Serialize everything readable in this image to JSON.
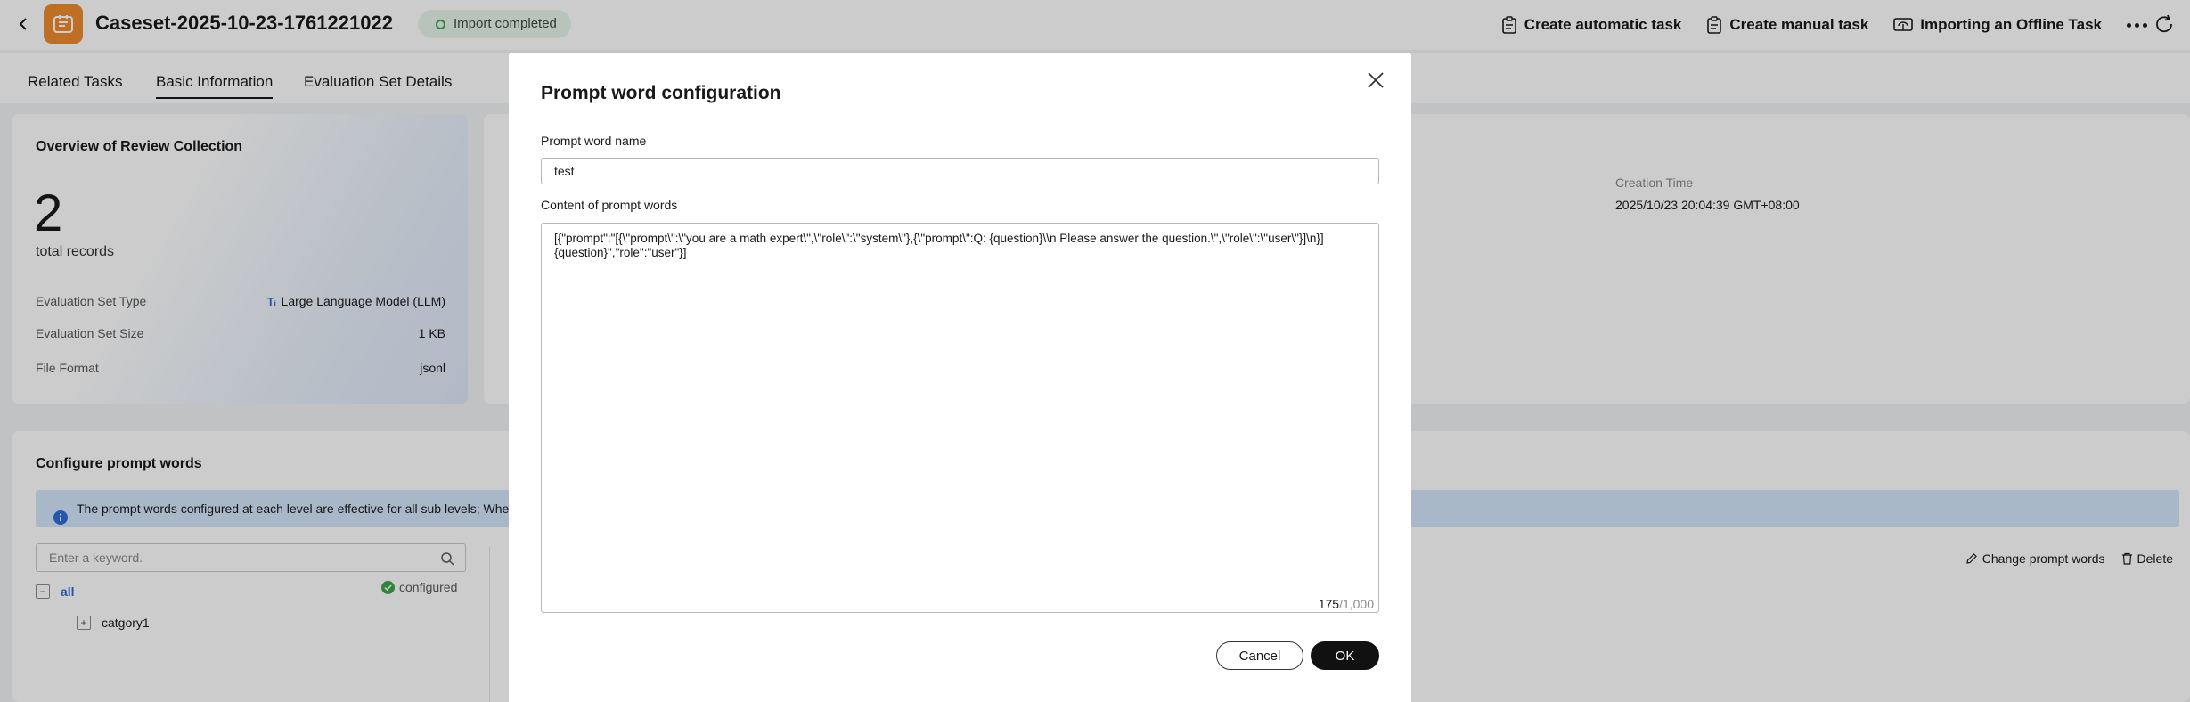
{
  "header": {
    "title": "Caseset-2025-10-23-1761221022",
    "status": "Import completed",
    "actions": {
      "create_automatic_task": "Create automatic task",
      "create_manual_task": "Create manual task",
      "importing_offline_task": "Importing an Offline Task"
    }
  },
  "tabs": [
    {
      "label": "Related Tasks",
      "active": false
    },
    {
      "label": "Basic Information",
      "active": true
    },
    {
      "label": "Evaluation Set Details",
      "active": false
    }
  ],
  "overview": {
    "title": "Overview of Review Collection",
    "count": "2",
    "count_label": "total records",
    "rows": [
      {
        "label": "Evaluation Set Type",
        "value": "Large Language Model (LLM)"
      },
      {
        "label": "Evaluation Set Size",
        "value": "1 KB"
      },
      {
        "label": "File Format",
        "value": "jsonl"
      }
    ]
  },
  "info": {
    "creation_time_label": "Creation Time",
    "creation_time_value": "2025/10/23 20:04:39 GMT+08:00"
  },
  "prompt_config": {
    "title": "Configure prompt words",
    "notice": "The prompt words configured at each level are effective for all sub levels; When m",
    "search_placeholder": "Enter a keyword.",
    "tree": {
      "root_label": "all",
      "root_status": "configured",
      "child_label": "catgory1"
    },
    "actions": {
      "change": "Change prompt words",
      "delete": "Delete"
    }
  },
  "modal": {
    "title": "Prompt word configuration",
    "name_label": "Prompt word name",
    "name_value": "test",
    "content_label": "Content of prompt words",
    "content_value": "[{\"prompt\":\"[{\\\"prompt\\\":\\\"you are a math expert\\\",\\\"role\\\":\\\"system\\\"},{\\\"prompt\\\":Q: {question}\\\\n Please answer the question.\\\",\\\"role\\\":\\\"user\\\"}]\\n}]{question}\",\"role\":\"user\"}]",
    "char_count": "175",
    "char_max": "/1,000",
    "cancel_label": "Cancel",
    "ok_label": "OK"
  },
  "colors": {
    "brand_orange": "#ef8b2c",
    "success_green": "#3aa54a",
    "link_blue": "#2f6bd8",
    "notice_bg": "#d4e6fb",
    "primary_button": "#111111"
  }
}
